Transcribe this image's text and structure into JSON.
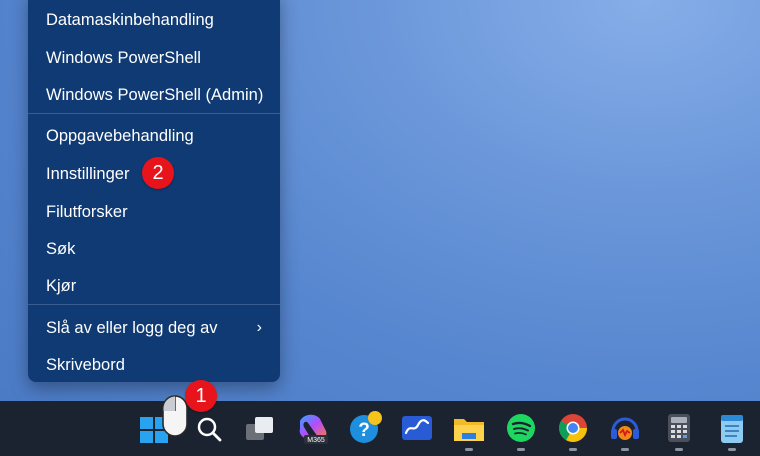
{
  "context_menu": {
    "items": [
      {
        "label": "Datamaskinbehandling"
      },
      {
        "label": "Windows PowerShell"
      },
      {
        "label": "Windows PowerShell (Admin)"
      },
      {
        "label": "Oppgavebehandling"
      },
      {
        "label": "Innstillinger"
      },
      {
        "label": "Filutforsker"
      },
      {
        "label": "Søk"
      },
      {
        "label": "Kjør"
      },
      {
        "label": "Slå av eller logg deg av",
        "submenu_icon": "chevron-right-icon"
      },
      {
        "label": "Skrivebord"
      }
    ]
  },
  "annotations": {
    "step_1": "1",
    "step_2": "2",
    "badge_color": "#e8141c"
  },
  "taskbar": {
    "icons": [
      {
        "name": "windows-start-icon"
      },
      {
        "name": "mouse-cursor-icon"
      },
      {
        "name": "search-icon"
      },
      {
        "name": "task-view-icon"
      },
      {
        "name": "microsoft-365-icon",
        "label": "M365"
      },
      {
        "name": "help-tips-icon"
      },
      {
        "name": "whiteboard-icon"
      },
      {
        "name": "file-explorer-icon"
      },
      {
        "name": "spotify-icon"
      },
      {
        "name": "chrome-icon"
      },
      {
        "name": "audio-app-icon"
      },
      {
        "name": "calculator-icon"
      },
      {
        "name": "notepad-icon"
      }
    ],
    "background": "#1b2331"
  },
  "menu_background": "#0f3a73"
}
